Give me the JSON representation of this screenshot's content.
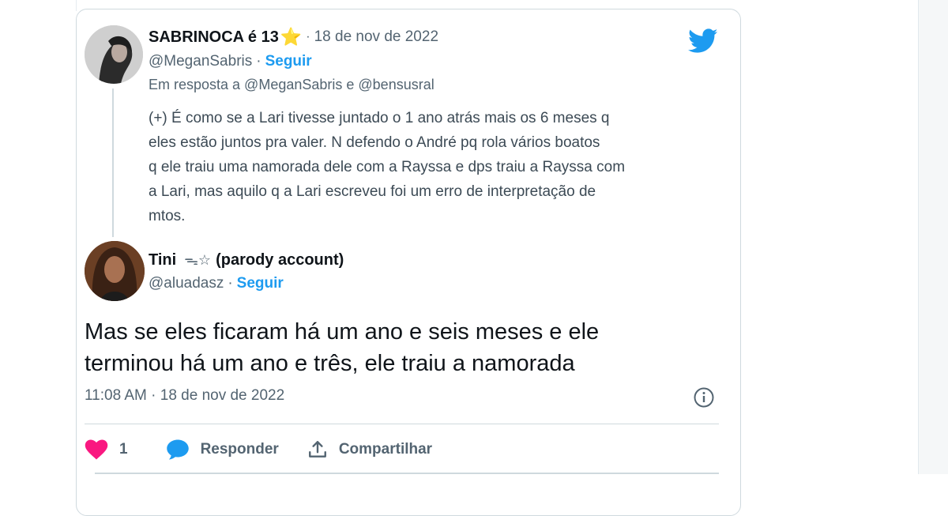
{
  "parent_tweet": {
    "display_name": "SABRINOCA é 13",
    "name_emoji": "⭐",
    "date": "18 de nov de 2022",
    "handle": "@MeganSabris",
    "follow_label": "Seguir",
    "reply_context": "Em resposta a @MeganSabris e @bensusral",
    "text": "(+) É como se a Lari tivesse juntado o 1 ano atrás mais os 6 meses q\neles estão juntos pra valer. N defendo o André pq rola vários boatos\nq ele traiu uma namorada dele com a Rayssa e dps traiu a Rayssa com\na Lari, mas aquilo q a Lari escreveu foi um erro de interpretação de\nmtos."
  },
  "main_tweet": {
    "display_name": "Tini",
    "name_suffix": "ᯓ☆",
    "name_note": "(parody account)",
    "handle": "@aluadasz",
    "follow_label": "Seguir",
    "text": "Mas se eles ficaram há um ano e seis meses e ele\nterminou há um ano e três, ele traiu a namorada",
    "timestamp": "11:08 AM · 18 de nov de 2022"
  },
  "actions": {
    "like_count": "1",
    "reply_label": "Responder",
    "share_label": "Compartilhar"
  },
  "icons": {
    "brand": "twitter-bird-icon",
    "info": "info-icon",
    "like": "heart-icon",
    "reply": "speech-bubble-icon",
    "share": "share-icon"
  },
  "colors": {
    "accent": "#1d9bf0",
    "like": "#f91880",
    "star": "#f6a623",
    "muted": "#536471"
  },
  "separator": "·"
}
